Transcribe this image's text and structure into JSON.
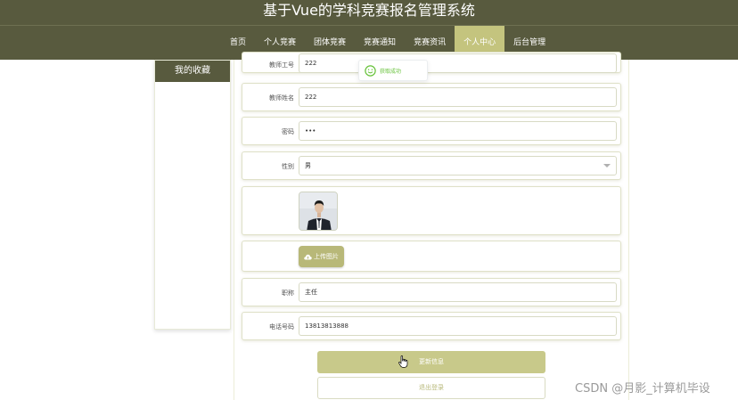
{
  "header": {
    "title": "基于Vue的学科竞赛报名管理系统",
    "nav": [
      "首页",
      "个人竞赛",
      "团体竞赛",
      "竞赛通知",
      "竞赛资讯",
      "个人中心",
      "后台管理"
    ],
    "active_nav": "个人中心"
  },
  "sidebar": {
    "heading": "我的收藏"
  },
  "toast": {
    "text": "获取成功",
    "icon": "smile-icon",
    "color": "#67c23a"
  },
  "form": {
    "teacher_id": {
      "label": "教师工号",
      "value": "222"
    },
    "teacher_name": {
      "label": "教师姓名",
      "value": "222"
    },
    "password": {
      "label": "密码",
      "value": "•••"
    },
    "gender": {
      "label": "性别",
      "value": "男"
    },
    "photo": {
      "icon": "person-photo"
    },
    "upload": {
      "label": "上传图片",
      "icon": "cloud-upload-icon"
    },
    "title_field": {
      "label": "职称",
      "value": "主任"
    },
    "phone": {
      "label": "电话号码",
      "value": "13813813888"
    }
  },
  "buttons": {
    "update": "更新信息",
    "logout": "退出登录"
  },
  "watermark": "CSDN @月影_计算机毕设",
  "colors": {
    "header_bg": "#585a3e",
    "accent": "#c4c47e",
    "button": "#c8c98a"
  }
}
